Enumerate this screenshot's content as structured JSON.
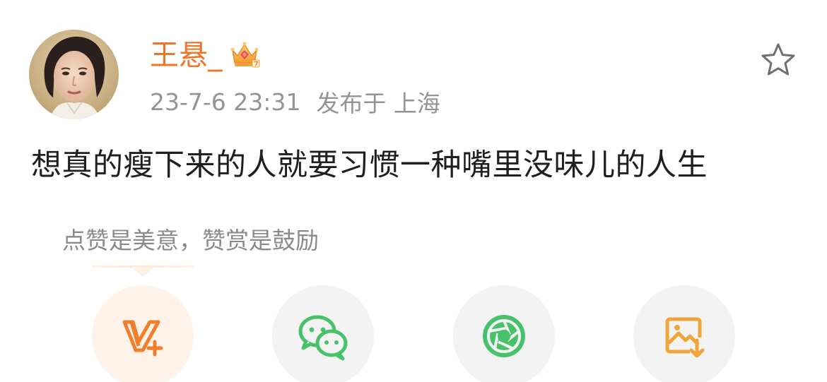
{
  "post": {
    "author": {
      "name": "王悬_",
      "badge_icon": "crown-badge-icon",
      "avatar_icon": "avatar"
    },
    "meta": {
      "datetime": "23-7-6 23:31",
      "location": "发布于 上海"
    },
    "favorite_icon": "star-outline-icon",
    "text": "想真的瘦下来的人就要习惯一种嘴里没味儿的人生"
  },
  "reward": {
    "hint": "点赞是美意，赞赏是鼓励"
  },
  "share_actions": [
    {
      "name": "vplus-icon",
      "accent": "#f07f2c"
    },
    {
      "name": "wechat-icon",
      "accent": "#48c26a"
    },
    {
      "name": "moments-icon",
      "accent": "#48c26a"
    },
    {
      "name": "save-image-icon",
      "accent": "#f0a43a"
    }
  ],
  "colors": {
    "username": "#f0752a",
    "meta_text": "#949494",
    "body_text": "#1f1f1f",
    "hint_text": "#8a8a8a",
    "button_bg": "#f3f3f3",
    "vplus_bg": "#fff2e8"
  }
}
